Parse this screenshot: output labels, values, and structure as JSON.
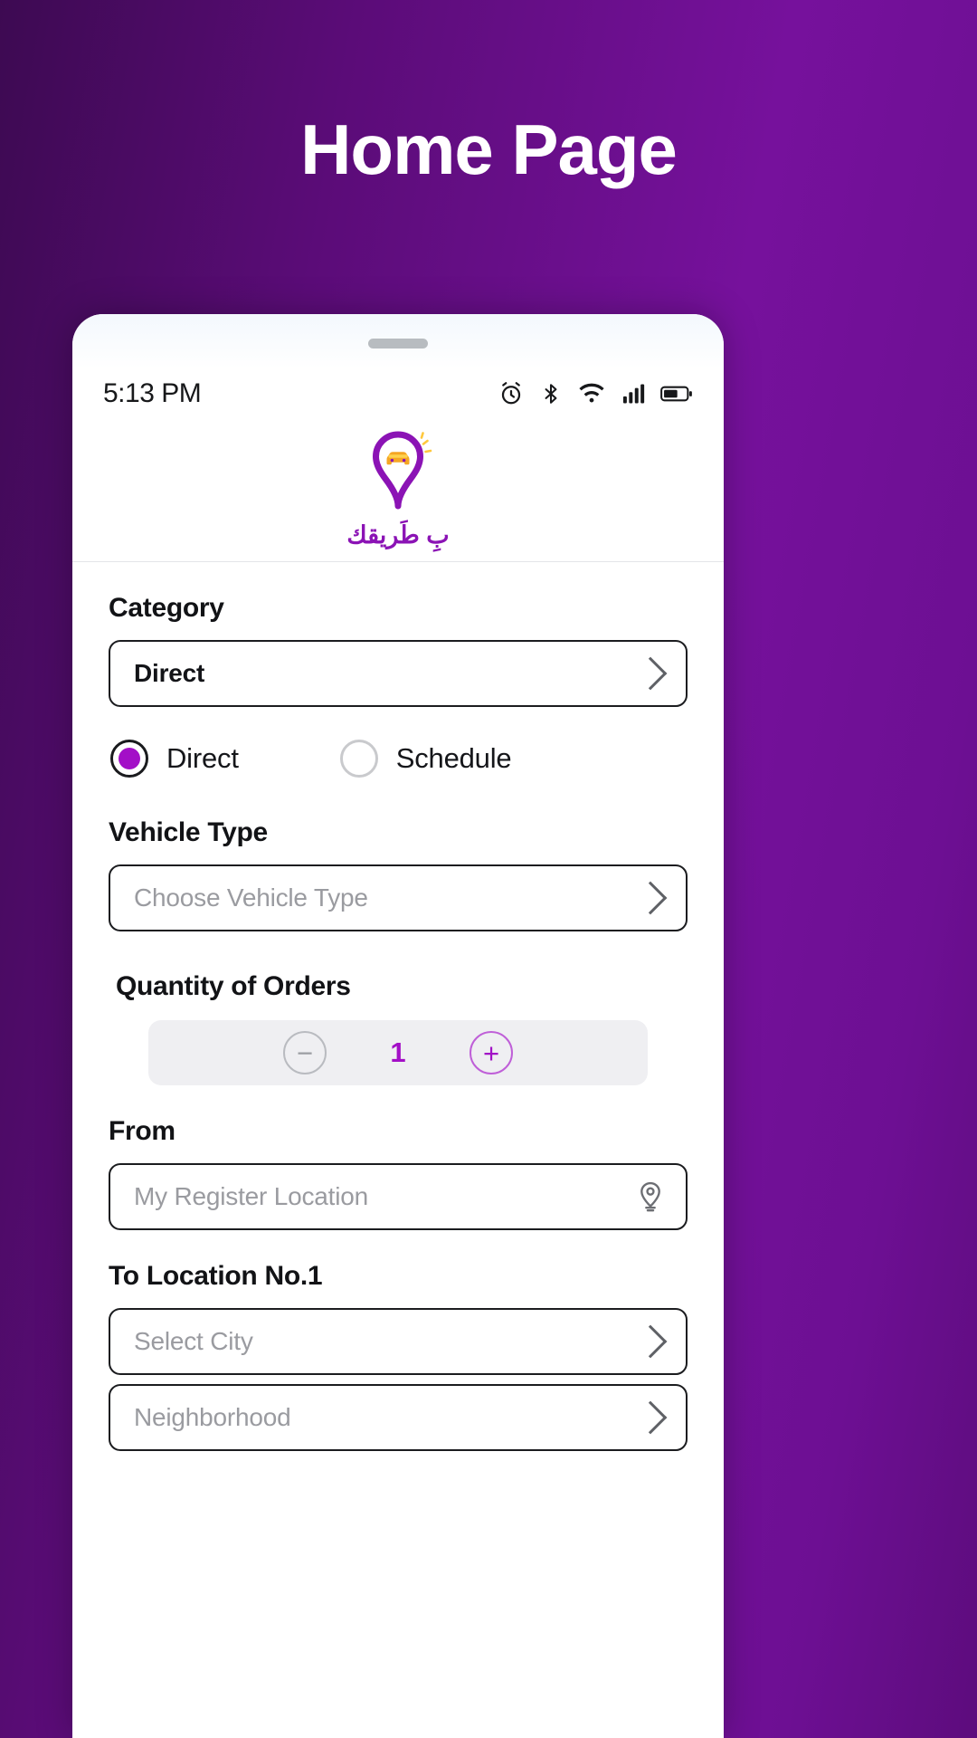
{
  "hero": {
    "title": "Home Page"
  },
  "theme": {
    "background_gradient_from": "#3d0a52",
    "background_gradient_to": "#76119c",
    "accent_purple": "#a30fc7",
    "logo_purple": "#8b13b5",
    "logo_car_orange": "#f5a623",
    "text_dark": "#121316",
    "placeholder_gray": "#9a9ba0",
    "qty_bar_bg": "#efeff2"
  },
  "phone": {
    "statusbar": {
      "time": "5:13 PM",
      "icons": [
        "alarm-icon",
        "bluetooth-icon",
        "wifi-icon",
        "cellular-signal-icon",
        "battery-icon"
      ]
    },
    "logo": {
      "mark": "map-pin-car-icon",
      "text": "بِ طَريقك"
    }
  },
  "form": {
    "category": {
      "label": "Category",
      "value": "Direct",
      "chevron": "chevron-right-icon"
    },
    "mode_radios": [
      {
        "label": "Direct",
        "selected": true
      },
      {
        "label": "Schedule",
        "selected": false
      }
    ],
    "vehicle_type": {
      "label": "Vehicle Type",
      "placeholder": "Choose Vehicle Type",
      "value": "",
      "chevron": "chevron-right-icon"
    },
    "quantity": {
      "label": "Quantity of Orders",
      "value": "1",
      "decrement_label": "−",
      "increment_label": "+"
    },
    "from": {
      "label": "From",
      "placeholder": "My Register Location",
      "value": "",
      "icon": "location-pin-icon"
    },
    "to_location_1": {
      "label": "To Location No.1",
      "city": {
        "placeholder": "Select City",
        "value": "",
        "chevron": "chevron-right-icon"
      },
      "neighborhood": {
        "placeholder": "Neighborhood",
        "value": "",
        "chevron": "chevron-right-icon"
      }
    }
  }
}
